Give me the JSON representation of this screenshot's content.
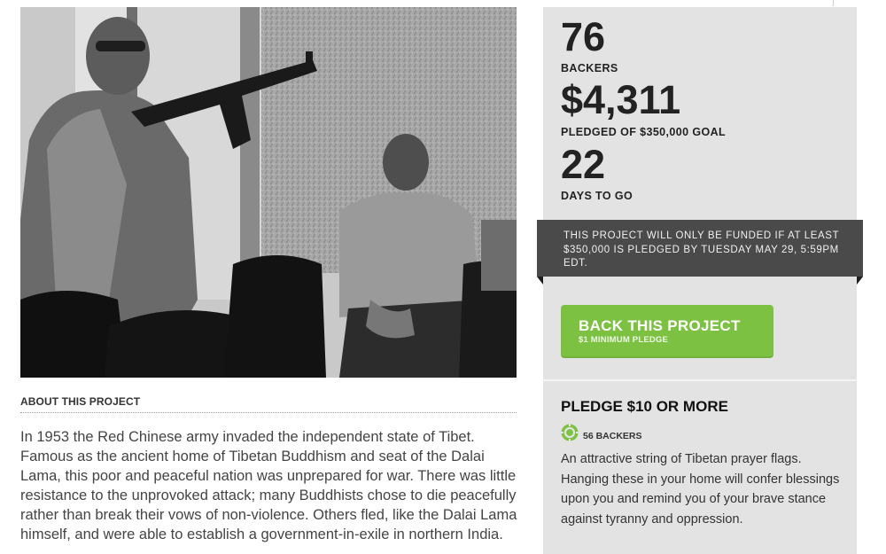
{
  "about": {
    "heading": "ABOUT THIS PROJECT",
    "text": "In 1953 the Red Chinese army invaded the independent state of Tibet. Famous as the ancient home of Tibetan Buddhism and seat of the Dalai Lama, this poor and peaceful nation was unprepared for war. There was little resistance to the unprovoked attack; many Buddhists chose to die peacefully rather than break their vows of non-violence. Others fled, like the Dalai Lama himself, and were able to establish a government-in-exile in northern India."
  },
  "stats": {
    "backers_count": "76",
    "backers_label": "BACKERS",
    "pledged_amount": "$4,311",
    "pledged_label": "PLEDGED OF $350,000 GOAL",
    "days_count": "22",
    "days_label": "DAYS TO GO"
  },
  "notice": {
    "text": "THIS PROJECT WILL ONLY BE FUNDED IF AT LEAST $350,000 IS PLEDGED BY TUESDAY MAY 29, 5:59PM EDT."
  },
  "back_button": {
    "label": "BACK THIS PROJECT",
    "sublabel": "$1 MINIMUM PLEDGE",
    "color": "#7dc143"
  },
  "reward": {
    "title": "PLEDGE $10 OR MORE",
    "backers": "56 BACKERS",
    "icon": "reward-badge-icon",
    "description": "An attractive string of Tibetan prayer flags. Hanging these in your home will confer blessings upon you and remind you of your brave stance against tyranny and oppression."
  }
}
